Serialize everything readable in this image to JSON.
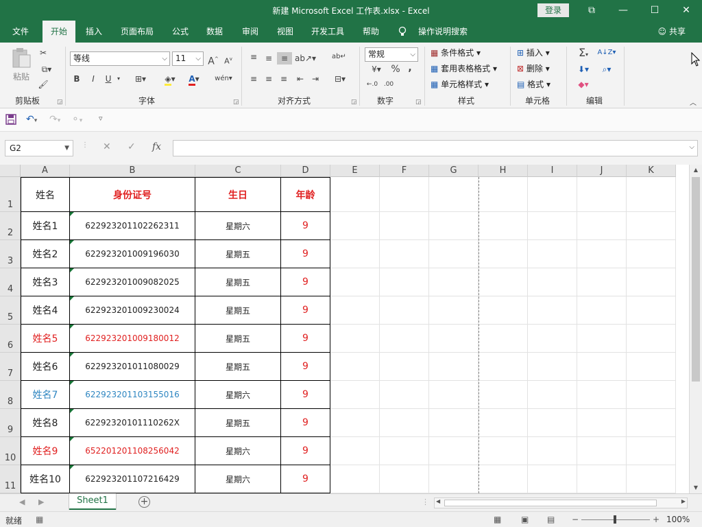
{
  "window": {
    "title": "新建 Microsoft Excel 工作表.xlsx  -  Excel",
    "login": "登录",
    "controls": [
      "⧉",
      "—",
      "☐",
      "✕"
    ]
  },
  "menu": {
    "tabs": [
      "文件",
      "开始",
      "插入",
      "页面布局",
      "公式",
      "数据",
      "审阅",
      "视图",
      "开发工具",
      "帮助"
    ],
    "active": "开始",
    "tell_me": "操作说明搜索",
    "share": "共享"
  },
  "ribbon": {
    "clipboard": {
      "label": "剪贴板",
      "paste": "粘贴"
    },
    "font": {
      "label": "字体",
      "font_name": "等线",
      "font_size": "11",
      "bold": "B",
      "italic": "I",
      "underline": "U"
    },
    "alignment": {
      "label": "对齐方式"
    },
    "number": {
      "label": "数字",
      "format": "常规",
      "percent": "%",
      "comma": ","
    },
    "styles": {
      "label": "样式",
      "conditional": "条件格式",
      "table_format": "套用表格格式",
      "cell_styles": "单元格样式"
    },
    "cells": {
      "label": "单元格",
      "insert": "插入",
      "delete": "删除",
      "format": "格式"
    },
    "editing": {
      "label": "编辑"
    }
  },
  "formula_bar": {
    "name_box": "G2",
    "formula": ""
  },
  "columns": [
    "A",
    "B",
    "C",
    "D",
    "E",
    "F",
    "G",
    "H",
    "I",
    "J",
    "K"
  ],
  "rows": [
    "1",
    "2",
    "3",
    "4",
    "5",
    "6",
    "7",
    "8",
    "9",
    "10",
    "11"
  ],
  "table": {
    "headers": [
      "姓名",
      "身份证号",
      "生日",
      "年龄"
    ],
    "data": [
      {
        "name": "姓名1",
        "id": "622923201102262311",
        "birthday": "星期六",
        "age": "9",
        "color": "#222222"
      },
      {
        "name": "姓名2",
        "id": "622923201009196030",
        "birthday": "星期五",
        "age": "9",
        "color": "#222222"
      },
      {
        "name": "姓名3",
        "id": "622923201009082025",
        "birthday": "星期五",
        "age": "9",
        "color": "#222222"
      },
      {
        "name": "姓名4",
        "id": "622923201009230024",
        "birthday": "星期五",
        "age": "9",
        "color": "#222222"
      },
      {
        "name": "姓名5",
        "id": "622923201009180012",
        "birthday": "星期五",
        "age": "9",
        "color": "#e02020"
      },
      {
        "name": "姓名6",
        "id": "622923201011080029",
        "birthday": "星期五",
        "age": "9",
        "color": "#222222"
      },
      {
        "name": "姓名7",
        "id": "622923201103155016",
        "birthday": "星期六",
        "age": "9",
        "color": "#2e86c1"
      },
      {
        "name": "姓名8",
        "id": "62292320101110262X",
        "birthday": "星期五",
        "age": "9",
        "color": "#222222"
      },
      {
        "name": "姓名9",
        "id": "652201201108256042",
        "birthday": "星期六",
        "age": "9",
        "color": "#e02020"
      },
      {
        "name": "姓名10",
        "id": "622923201107216429",
        "birthday": "星期六",
        "age": "9",
        "color": "#222222"
      }
    ]
  },
  "sheet_tabs": [
    "Sheet1"
  ],
  "status": {
    "ready": "就绪",
    "zoom": "100%"
  },
  "colors": {
    "accent": "#217346",
    "header_red": "#e02020",
    "highlight_blue": "#2e86c1",
    "error_triangle": "#1a7a3a"
  }
}
